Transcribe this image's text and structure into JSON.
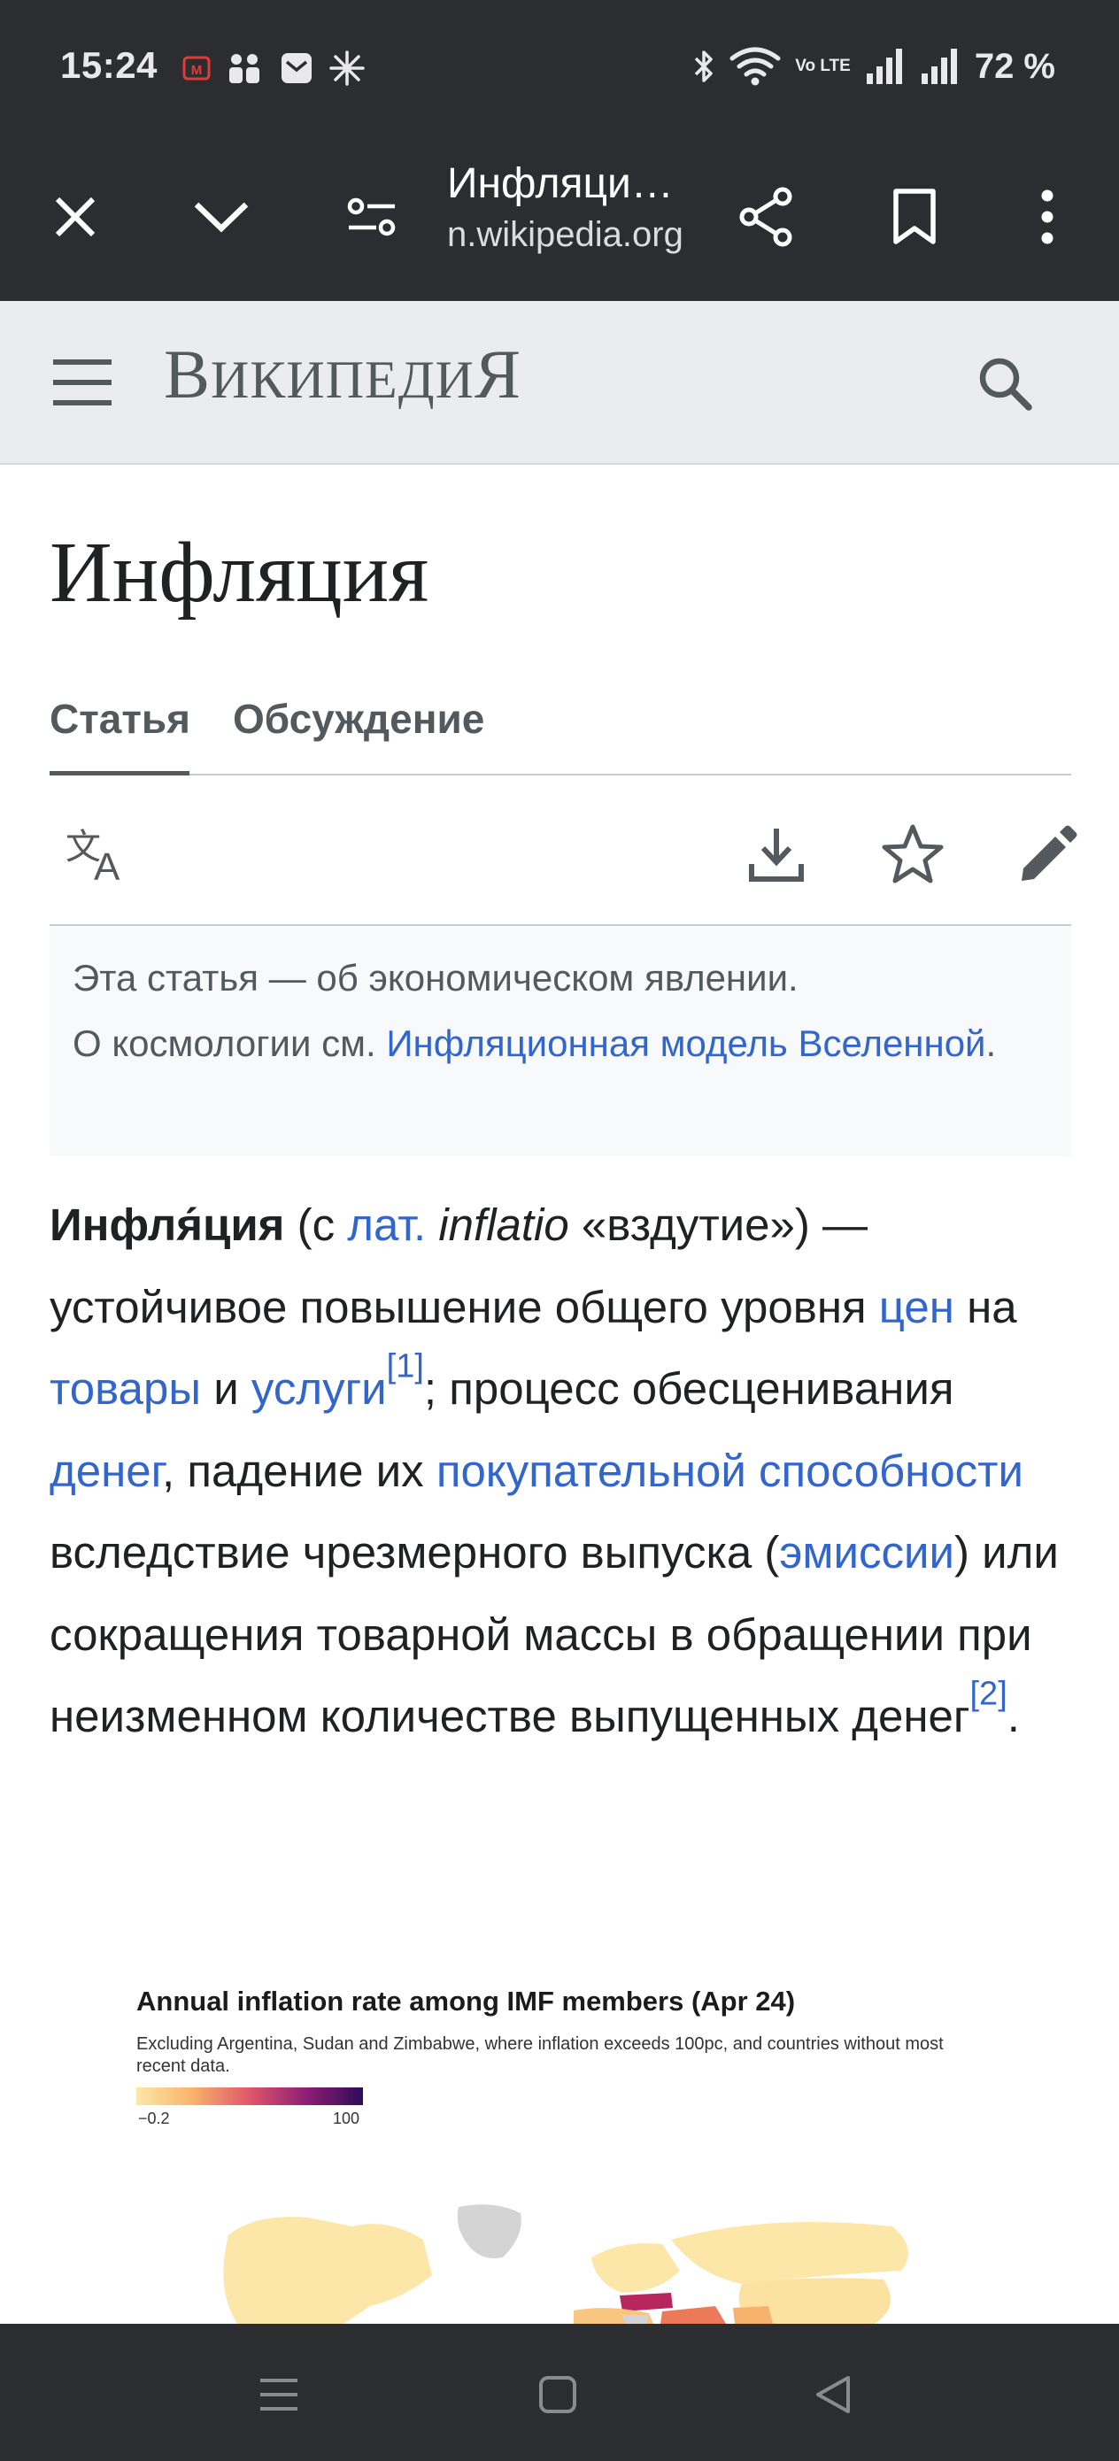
{
  "status_bar": {
    "time": "15:24",
    "battery": "72 %",
    "network_label": "Vo LTE",
    "icons_left": [
      "notification-app-icon",
      "people-app-icon",
      "mail-app-icon",
      "sparkle-app-icon"
    ],
    "icons_right": [
      "bluetooth-icon",
      "wifi-icon",
      "volte-icon",
      "signal-icon",
      "signal-icon"
    ]
  },
  "browser": {
    "tab_title": "Инфляци…",
    "host": "n.wikipedia.org",
    "buttons": [
      "close",
      "collapse",
      "site-settings",
      "share",
      "bookmark",
      "more"
    ]
  },
  "wiki_header": {
    "logo_text": "ВикипедиЯ"
  },
  "article": {
    "title": "Инфляция",
    "tabs": [
      {
        "label": "Статья",
        "active": true
      },
      {
        "label": "Обсуждение",
        "active": false
      }
    ],
    "actions": [
      "translate",
      "download",
      "watch",
      "edit"
    ],
    "hatnote": {
      "line1": "Эта статья — об экономическом явлении.",
      "line2_prefix": "О космологии см. ",
      "link": "Инфляционная модель Вселенной",
      "suffix": "."
    },
    "lead": {
      "term": "Инфля́ция",
      "p1": " (с ",
      "link_lat": "лат.",
      "p2": " ",
      "latin_word": "inflatio",
      "p3": " «вздутие») — устойчивое повышение общего уровня ",
      "link_prices": "цен",
      "p4": " на ",
      "link_goods": "товары",
      "p5": " и ",
      "link_services": "услуги",
      "ref1": "[1]",
      "p6": "; процесс обесценивания ",
      "link_money": "денег",
      "p7": ", падение их ",
      "link_purchasing": "покупательной способности",
      "p8": " вследствие чрезмерного выпуска (",
      "link_emission": "эмиссии",
      "p9": ") или сокращения товарной массы в обращении при неизменном количестве выпущенных денег",
      "ref2": "[2]",
      "p10": "."
    }
  },
  "figure": {
    "title": "Annual inflation rate among IMF members (Apr 24)",
    "subtitle": "Excluding Argentina, Sudan and Zimbabwe, where inflation exceeds 100pc, and countries without most recent data.",
    "legend_min": "−0.2",
    "legend_max": "100",
    "colors": {
      "low": "#fde7a8",
      "mid": "#f7b36b",
      "high": "#e0566a",
      "very_high": "#8d1e73",
      "no_data": "#d4d4d4"
    }
  },
  "nav_bar": {
    "buttons": [
      "recents",
      "home",
      "back"
    ]
  },
  "colors": {
    "chrome_dark": "#2c2d31",
    "wiki_header_bg": "#eaecf0",
    "link": "#3366cc",
    "text": "#202122",
    "muted": "#54595d"
  }
}
